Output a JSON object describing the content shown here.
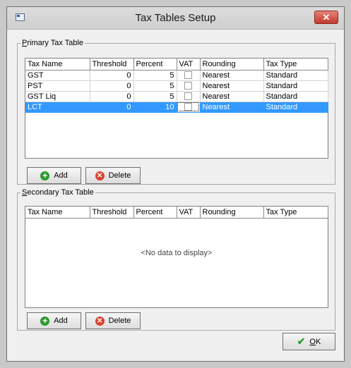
{
  "window": {
    "title": "Tax Tables Setup",
    "close_glyph": "✕"
  },
  "primary": {
    "legend_mnemonic": "P",
    "legend_rest": "rimary Tax Table",
    "columns": [
      "Tax Name",
      "Threshold",
      "Percent",
      "VAT",
      "Rounding",
      "Tax Type"
    ],
    "rows": [
      {
        "name": "GST",
        "threshold": "0",
        "percent": "5",
        "vat": false,
        "rounding": "Nearest",
        "type": "Standard"
      },
      {
        "name": "PST",
        "threshold": "0",
        "percent": "5",
        "vat": false,
        "rounding": "Nearest",
        "type": "Standard"
      },
      {
        "name": "GST Liq",
        "threshold": "0",
        "percent": "5",
        "vat": false,
        "rounding": "Nearest",
        "type": "Standard"
      },
      {
        "name": "LCT",
        "threshold": "0",
        "percent": "10",
        "vat": false,
        "rounding": "Nearest",
        "type": "Standard",
        "selected": true
      }
    ],
    "add_label": "Add",
    "delete_label": "Delete"
  },
  "secondary": {
    "legend_mnemonic": "S",
    "legend_rest": "econdary Tax Table",
    "columns": [
      "Tax Name",
      "Threshold",
      "Percent",
      "VAT",
      "Rounding",
      "Tax Type"
    ],
    "empty_text": "<No data to display>",
    "add_label": "Add",
    "delete_label": "Delete"
  },
  "ok": {
    "mnemonic": "O",
    "rest": "K"
  },
  "icons": {
    "add": "add-icon",
    "delete": "delete-icon",
    "ok": "checkmark-icon",
    "app": "app-icon",
    "close": "close-icon"
  },
  "colors": {
    "selection": "#3399ff",
    "close_button": "#c2392b",
    "add_icon": "#2e9b2e",
    "delete_icon": "#d9432f"
  }
}
